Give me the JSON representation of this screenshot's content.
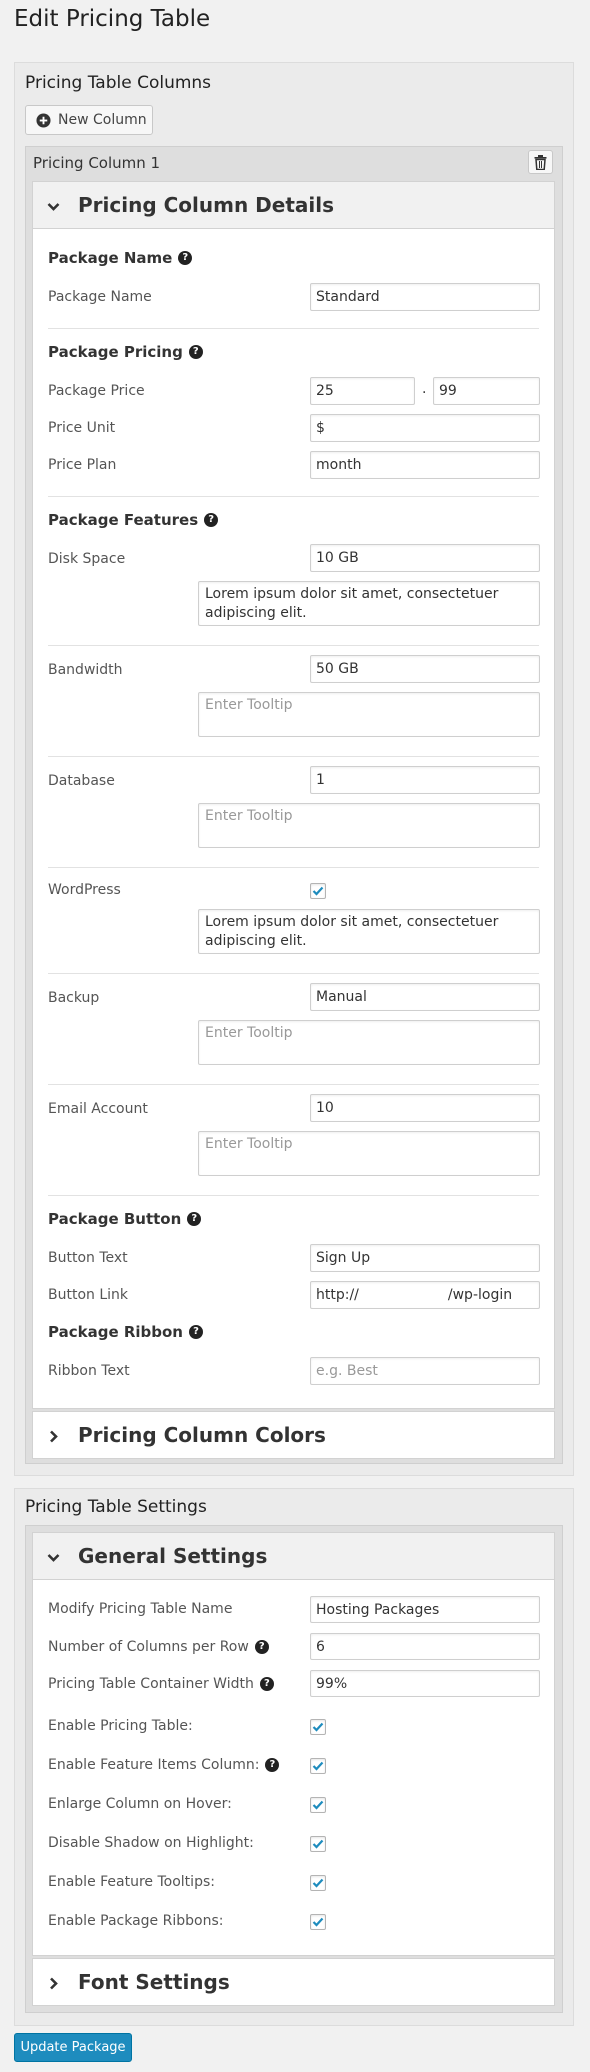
{
  "page_title": "Edit Pricing Table",
  "columns_section": {
    "title": "Pricing Table Columns",
    "new_column_label": "New Column"
  },
  "column": {
    "header": "Pricing Column 1",
    "details_title": "Pricing Column Details",
    "package_name": {
      "group": "Package Name",
      "label": "Package Name",
      "value": "Standard"
    },
    "package_pricing": {
      "group": "Package Pricing",
      "price_label": "Package Price",
      "price_whole": "25",
      "price_sep": ".",
      "price_cents": "99",
      "unit_label": "Price Unit",
      "unit_value": "$",
      "plan_label": "Price Plan",
      "plan_value": "month"
    },
    "features_group": "Package Features",
    "features": [
      {
        "label": "Disk Space",
        "value": "10 GB",
        "tooltip": "Lorem ipsum dolor sit amet, consectetuer adipiscing elit.",
        "tooltip_placeholder": "Enter Tooltip"
      },
      {
        "label": "Bandwidth",
        "value": "50 GB",
        "tooltip": "",
        "tooltip_placeholder": "Enter Tooltip"
      },
      {
        "label": "Database",
        "value": "1",
        "tooltip": "",
        "tooltip_placeholder": "Enter Tooltip"
      },
      {
        "label": "WordPress",
        "checked": true,
        "tooltip": "Lorem ipsum dolor sit amet, consectetuer adipiscing elit.",
        "tooltip_placeholder": "Enter Tooltip"
      },
      {
        "label": "Backup",
        "value": "Manual",
        "tooltip": "",
        "tooltip_placeholder": "Enter Tooltip"
      },
      {
        "label": "Email Account",
        "value": "10",
        "tooltip": "",
        "tooltip_placeholder": "Enter Tooltip"
      }
    ],
    "package_button": {
      "group": "Package Button",
      "text_label": "Button Text",
      "text_value": "Sign Up",
      "link_label": "Button Link",
      "link_value": "http://                    /wp-login"
    },
    "package_ribbon": {
      "group": "Package Ribbon",
      "label": "Ribbon Text",
      "placeholder": "e.g. Best"
    },
    "colors_title": "Pricing Column Colors"
  },
  "settings_section": {
    "title": "Pricing Table Settings",
    "general_title": "General Settings",
    "fields": [
      {
        "label": "Modify Pricing Table Name",
        "value": "Hosting Packages",
        "help": false
      },
      {
        "label": "Number of Columns per Row",
        "value": "6",
        "help": true
      },
      {
        "label": "Pricing Table Container Width",
        "value": "99%",
        "help": true
      }
    ],
    "toggles": [
      {
        "label": "Enable Pricing Table:",
        "checked": true,
        "help": false
      },
      {
        "label": "Enable Feature Items Column:",
        "checked": true,
        "help": true
      },
      {
        "label": "Enlarge Column on Hover:",
        "checked": true,
        "help": false
      },
      {
        "label": "Disable Shadow on Highlight:",
        "checked": true,
        "help": false
      },
      {
        "label": "Enable Feature Tooltips:",
        "checked": true,
        "help": false
      },
      {
        "label": "Enable Package Ribbons:",
        "checked": true,
        "help": false
      }
    ],
    "font_title": "Font Settings"
  },
  "update_button_label": "Update Package",
  "help_glyph": "?",
  "colors": {
    "primary": "#1e8cbe",
    "checkmark": "#1e8cbe"
  }
}
